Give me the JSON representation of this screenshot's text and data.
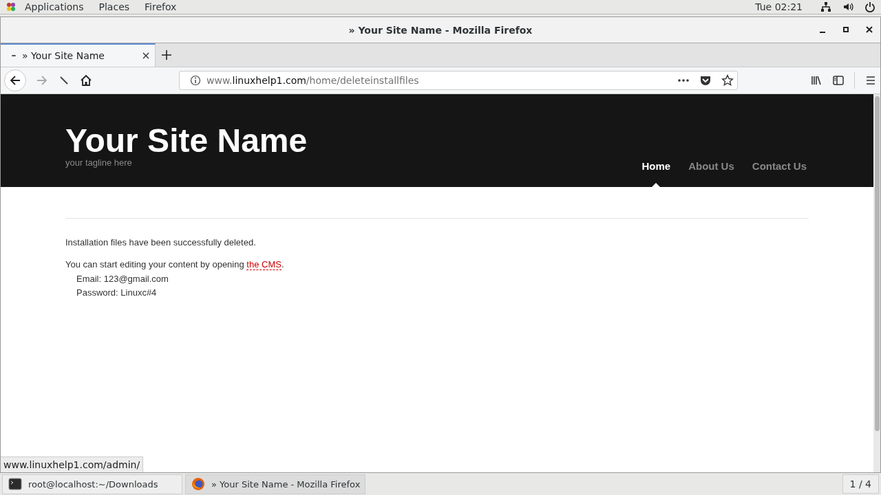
{
  "top_bar": {
    "menus": [
      "Applications",
      "Places",
      "Firefox"
    ],
    "clock": "Tue 02:21"
  },
  "window": {
    "title": "» Your Site Name - Mozilla Firefox"
  },
  "tabs": [
    {
      "label": "» Your Site Name",
      "selected": true
    }
  ],
  "address_bar": {
    "prefix": "www.",
    "domain": "linuxhelp1.com",
    "path": "/home/deleteinstallfiles"
  },
  "site": {
    "title": "Your Site Name",
    "tagline": "your tagline here",
    "nav": [
      {
        "label": "Home",
        "selected": true
      },
      {
        "label": "About Us",
        "selected": false
      },
      {
        "label": "Contact Us",
        "selected": false
      }
    ]
  },
  "content": {
    "message": "Installation files have been successfully deleted.",
    "intro": "You can start editing your content by opening ",
    "link": "the CMS",
    "after_link": ".",
    "credentials": [
      "Email: 123@gmail.com",
      "Password: Linuxc#4"
    ]
  },
  "status_link": "www.linuxhelp1.com/admin/",
  "taskbar": {
    "items": [
      {
        "kind": "terminal",
        "label": "root@localhost:~/Downloads",
        "selected": false
      },
      {
        "kind": "firefox",
        "label": "» Your Site Name - Mozilla Firefox",
        "selected": true
      }
    ],
    "workspace": "1 / 4"
  }
}
